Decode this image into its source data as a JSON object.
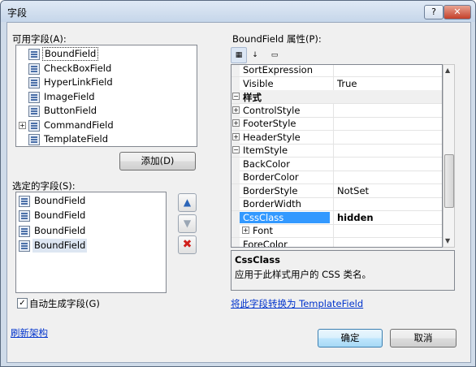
{
  "window": {
    "title": "字段",
    "help_glyph": "?",
    "close_glyph": "✕"
  },
  "available_fields": {
    "label": "可用字段(A):",
    "items": [
      {
        "label": "BoundField",
        "icon": "bound-field-icon",
        "selected": true
      },
      {
        "label": "CheckBoxField",
        "icon": "checkbox-field-icon"
      },
      {
        "label": "HyperLinkField",
        "icon": "hyperlink-field-icon"
      },
      {
        "label": "ImageField",
        "icon": "image-field-icon"
      },
      {
        "label": "ButtonField",
        "icon": "button-field-icon"
      },
      {
        "label": "CommandField",
        "icon": "command-field-icon",
        "expander": "+"
      },
      {
        "label": "TemplateField",
        "icon": "template-field-icon"
      }
    ]
  },
  "add_button": {
    "label": "添加(D)"
  },
  "selected_fields": {
    "label": "选定的字段(S):",
    "items": [
      {
        "label": "BoundField"
      },
      {
        "label": "BoundField"
      },
      {
        "label": "BoundField"
      },
      {
        "label": "BoundField",
        "selected": true
      }
    ]
  },
  "reorder": {
    "up_glyph": "▲",
    "down_glyph": "▼",
    "delete_glyph": "✖"
  },
  "auto_generate": {
    "label": "自动生成字段(G)",
    "checked": true
  },
  "refresh_link": {
    "label": "刷新架构"
  },
  "properties": {
    "label": "BoundField 属性(P):",
    "rows": [
      {
        "name": "SortExpression",
        "value": ""
      },
      {
        "name": "Visible",
        "value": "True"
      },
      {
        "name": "样式",
        "value": "",
        "category": true,
        "expander": "−"
      },
      {
        "name": "ControlStyle",
        "value": "",
        "expander": "+"
      },
      {
        "name": "FooterStyle",
        "value": "",
        "expander": "+"
      },
      {
        "name": "HeaderStyle",
        "value": "",
        "expander": "+"
      },
      {
        "name": "ItemStyle",
        "value": "",
        "expander": "−"
      },
      {
        "name": "BackColor",
        "value": "",
        "indent": true
      },
      {
        "name": "BorderColor",
        "value": "",
        "indent": true
      },
      {
        "name": "BorderStyle",
        "value": "NotSet",
        "indent": true
      },
      {
        "name": "BorderWidth",
        "value": "",
        "indent": true
      },
      {
        "name": "CssClass",
        "value": "hidden",
        "indent": true,
        "selected": true
      },
      {
        "name": "Font",
        "value": "",
        "indent": true,
        "expander": "+"
      },
      {
        "name": "ForeColor",
        "value": "",
        "indent": true
      }
    ]
  },
  "description": {
    "title": "CssClass",
    "text": "应用于此样式用户的 CSS 类名。"
  },
  "convert_link": {
    "label": "将此字段转换为 TemplateField"
  },
  "ok_button": {
    "label": "确定"
  },
  "cancel_button": {
    "label": "取消"
  }
}
